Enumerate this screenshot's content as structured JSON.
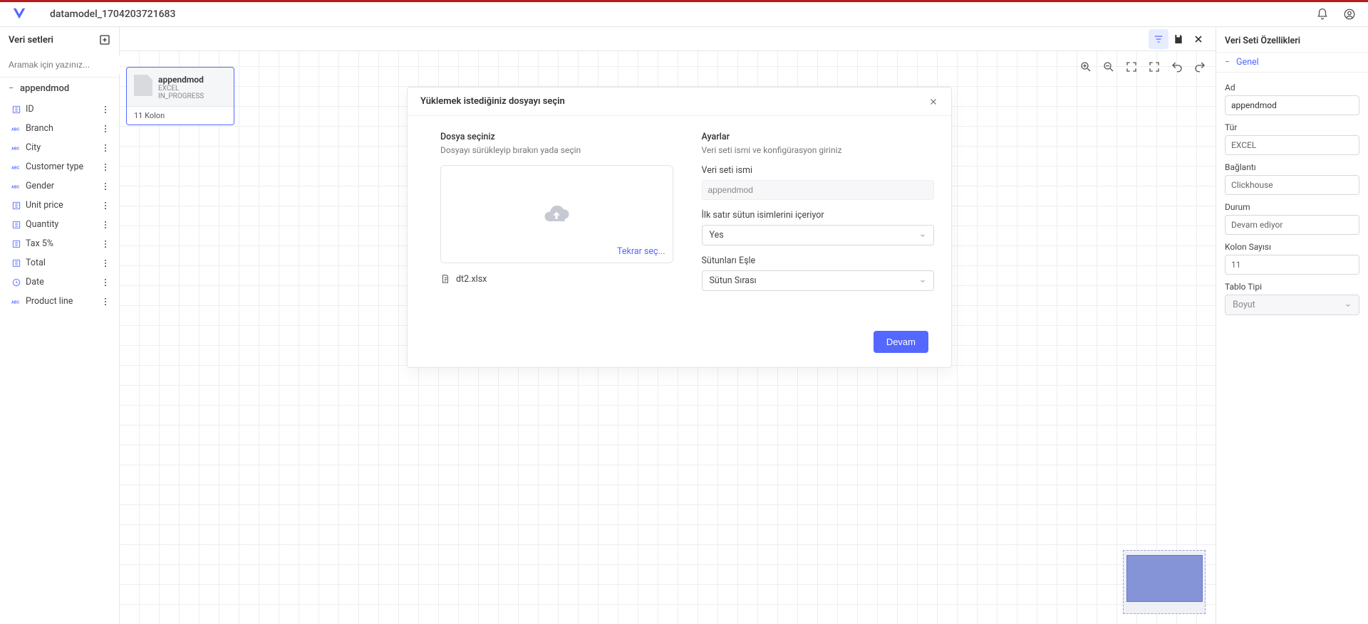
{
  "header": {
    "title": "datamodel_1704203721683"
  },
  "sidebar": {
    "title": "Veri setleri",
    "search_placeholder": "Aramak için yazınız...",
    "dataset": {
      "name": "appendmod",
      "columns": [
        {
          "type": "num",
          "name": "ID"
        },
        {
          "type": "abc",
          "name": "Branch"
        },
        {
          "type": "abc",
          "name": "City"
        },
        {
          "type": "abc",
          "name": "Customer type"
        },
        {
          "type": "abc",
          "name": "Gender"
        },
        {
          "type": "num",
          "name": "Unit price"
        },
        {
          "type": "num",
          "name": "Quantity"
        },
        {
          "type": "num",
          "name": "Tax 5%"
        },
        {
          "type": "num",
          "name": "Total"
        },
        {
          "type": "date",
          "name": "Date"
        },
        {
          "type": "abc",
          "name": "Product line"
        }
      ]
    }
  },
  "canvas": {
    "node": {
      "name": "appendmod",
      "source": "EXCEL",
      "status": "IN_PROGRESS",
      "footer": "11 Kolon"
    }
  },
  "modal": {
    "title": "Yüklemek istediğiniz dosyayı seçin",
    "left": {
      "heading": "Dosya seçiniz",
      "desc": "Dosyayı sürükleyip bırakın yada seçin",
      "retry": "Tekrar seç...",
      "file_name": "dt2.xlsx"
    },
    "right": {
      "heading": "Ayarlar",
      "desc": "Veri seti ismi ve konfigürasyon giriniz",
      "name_label": "Veri seti ismi",
      "name_value": "appendmod",
      "header_row_label": "İlk satır sütun isimlerini içeriyor",
      "header_row_value": "Yes",
      "columns_label": "Sütunları Eşle",
      "columns_value": "Sütun Sırası"
    },
    "continue": "Devam"
  },
  "rpanel": {
    "title": "Veri Seti Özellikleri",
    "section": "Genel",
    "fields": {
      "ad_label": "Ad",
      "ad": "appendmod",
      "tur_label": "Tür",
      "tur": "EXCEL",
      "baglanti_label": "Bağlantı",
      "baglanti": "Clickhouse",
      "durum_label": "Durum",
      "durum": "Devam ediyor",
      "kolon_label": "Kolon Sayısı",
      "kolon": "11",
      "tablo_label": "Tablo Tipi",
      "tablo": "Boyut"
    }
  }
}
